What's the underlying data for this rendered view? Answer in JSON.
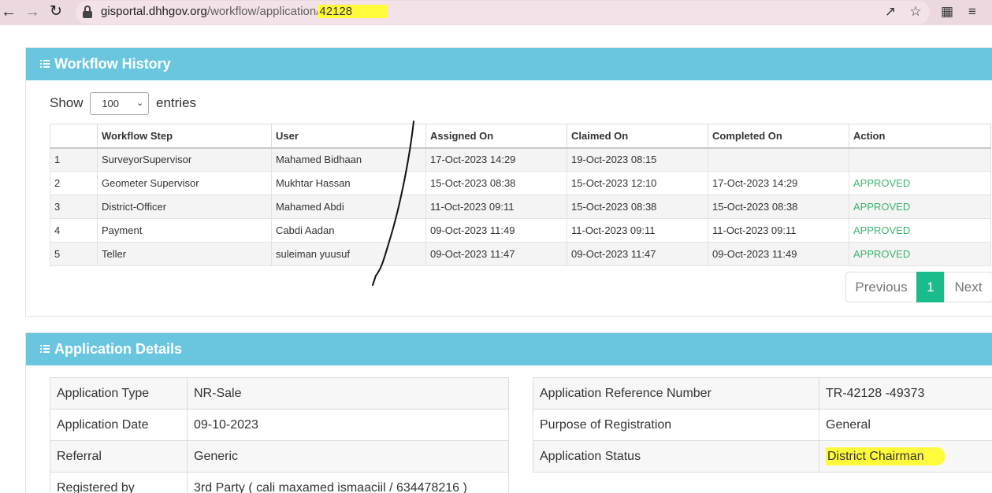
{
  "browser": {
    "url_host": "gisportal.dhhgov.org",
    "url_path": "/workflow/application/",
    "url_id": "42128",
    "back_icon": "back-arrow-icon",
    "forward_icon": "forward-arrow-icon",
    "reload_icon": "reload-icon",
    "share_icon": "share-icon",
    "bookmark_icon": "star-icon",
    "extensions_icon": "puzzle-icon",
    "reading_list_icon": "reading-list-icon"
  },
  "workflow": {
    "title": "Workflow History",
    "show_label": "Show",
    "entries_label": "entries",
    "page_size": "100",
    "columns": [
      "",
      "Workflow Step",
      "User",
      "Assigned On",
      "Claimed On",
      "Completed On",
      "Action"
    ],
    "rows": [
      [
        "1",
        "SurveyorSupervisor",
        "Mahamed Bidhaan",
        "17-Oct-2023 14:29",
        "19-Oct-2023 08:15",
        "",
        ""
      ],
      [
        "2",
        "Geometer Supervisor",
        "Mukhtar Hassan",
        "15-Oct-2023 08:38",
        "15-Oct-2023 12:10",
        "17-Oct-2023 14:29",
        "APPROVED"
      ],
      [
        "3",
        "District-Officer",
        "Mahamed Abdi",
        "11-Oct-2023 09:11",
        "15-Oct-2023 08:38",
        "15-Oct-2023 08:38",
        "APPROVED"
      ],
      [
        "4",
        "Payment",
        "Cabdi Aadan",
        "09-Oct-2023 11:49",
        "11-Oct-2023 09:11",
        "11-Oct-2023 09:11",
        "APPROVED"
      ],
      [
        "5",
        "Teller",
        "suleiman yuusuf",
        "09-Oct-2023 11:47",
        "09-Oct-2023 11:47",
        "09-Oct-2023 11:49",
        "APPROVED"
      ]
    ],
    "pagination": {
      "previous": "Previous",
      "current": "1",
      "next": "Next"
    }
  },
  "details": {
    "title": "Application Details",
    "left": [
      [
        "Application Type",
        "NR-Sale"
      ],
      [
        "Application Date",
        "09-10-2023"
      ],
      [
        "Referral",
        "Generic"
      ],
      [
        "Registered by",
        "3rd Party ( cali maxamed ismaaciil / 634478216 )"
      ]
    ],
    "right": [
      [
        "Application Reference Number",
        "TR-42128 -49373"
      ],
      [
        "Purpose of Registration",
        "General"
      ],
      [
        "Application Status",
        "District Chairman"
      ]
    ]
  },
  "colors": {
    "panel_header": "#6ac6df",
    "approved": "#3cb371",
    "pager_active": "#1abc8c",
    "highlight": "#fffb3a"
  }
}
